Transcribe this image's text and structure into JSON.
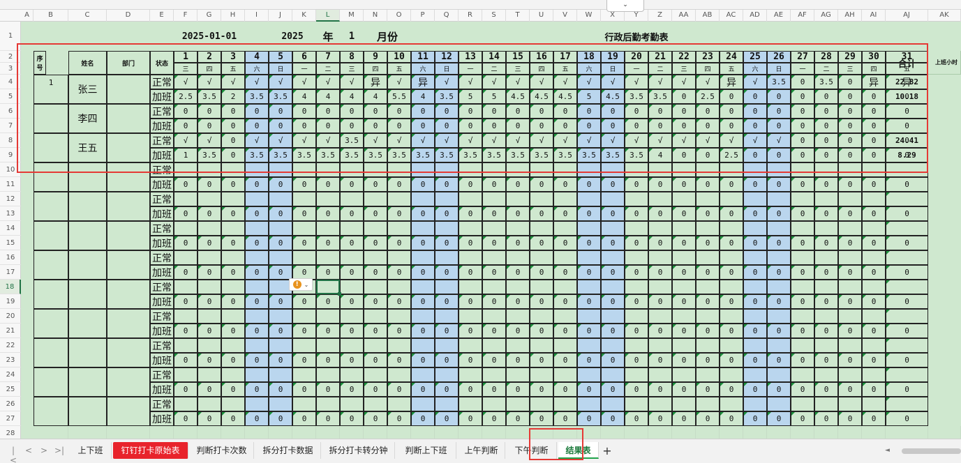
{
  "spreadsheet": {
    "columns": [
      "A",
      "B",
      "C",
      "D",
      "E",
      "F",
      "G",
      "H",
      "I",
      "J",
      "K",
      "L",
      "M",
      "N",
      "O",
      "P",
      "Q",
      "R",
      "S",
      "T",
      "U",
      "V",
      "W",
      "X",
      "Y",
      "Z",
      "AA",
      "AB",
      "AC",
      "AD",
      "AE",
      "AF",
      "AG",
      "AH",
      "AI",
      "AJ",
      "AK"
    ],
    "active_column": "L",
    "row_numbers": [
      "1",
      "2",
      "3",
      "4",
      "5",
      "6",
      "7",
      "8",
      "9",
      "10",
      "11",
      "12",
      "13",
      "14",
      "15",
      "16",
      "17",
      "18",
      "19",
      "20",
      "21",
      "22",
      "23",
      "24",
      "25",
      "26",
      "27",
      "28"
    ],
    "active_row": "18",
    "title_row": {
      "date": "2025-01-01",
      "year": "2025",
      "year_label": "年",
      "month": "1",
      "month_label": "月份",
      "title": "行政后勤考勤表"
    },
    "headers": {
      "seq": "序号",
      "name": "姓名",
      "dept": "部门",
      "status": "状态",
      "total": "合计",
      "overflow": "上班小时"
    },
    "days": [
      "1",
      "2",
      "3",
      "4",
      "5",
      "6",
      "7",
      "8",
      "9",
      "10",
      "11",
      "12",
      "13",
      "14",
      "15",
      "16",
      "17",
      "18",
      "19",
      "20",
      "21",
      "22",
      "23",
      "24",
      "25",
      "26",
      "27",
      "28",
      "29",
      "30",
      "31"
    ],
    "weekdays": [
      "三",
      "四",
      "五",
      "六",
      "日",
      "一",
      "二",
      "三",
      "四",
      "五",
      "六",
      "日",
      "一",
      "二",
      "三",
      "四",
      "五",
      "六",
      "日",
      "一",
      "二",
      "三",
      "四",
      "五",
      "六",
      "日",
      "一",
      "二",
      "三",
      "四",
      "五"
    ],
    "blue_day_indices": [
      3,
      4,
      10,
      11,
      17,
      18,
      24,
      25
    ],
    "status_labels": {
      "normal": "正常",
      "overtime": "加班"
    },
    "employees": [
      {
        "seq": "1",
        "name": "张三",
        "normal": [
          "√",
          "√",
          "√",
          "√",
          "√",
          "√",
          "√",
          "√",
          "异",
          "√",
          "异",
          "√",
          "√",
          "√",
          "√",
          "√",
          "√",
          "√",
          "√",
          "√",
          "√",
          "√",
          "√",
          "异",
          "√",
          "3.5",
          "0",
          "3.5",
          "0",
          "异",
          "异"
        ],
        "normal_total": "22.82",
        "overtime": [
          "2.5",
          "3.5",
          "2",
          "3.5",
          "3.5",
          "4",
          "4",
          "4",
          "4",
          "5.5",
          "4",
          "3.5",
          "5",
          "5",
          "4.5",
          "4.5",
          "4.5",
          "5",
          "4.5",
          "3.5",
          "3.5",
          "0",
          "2.5",
          "0",
          "0",
          "0",
          "0",
          "0",
          "0",
          "0",
          "0"
        ],
        "overtime_total": "10.18"
      },
      {
        "seq": "",
        "name": "李四",
        "normal": [
          "0",
          "0",
          "0",
          "0",
          "0",
          "0",
          "0",
          "0",
          "0",
          "0",
          "0",
          "0",
          "0",
          "0",
          "0",
          "0",
          "0",
          "0",
          "0",
          "0",
          "0",
          "0",
          "0",
          "0",
          "0",
          "0",
          "0",
          "0",
          "0",
          "0",
          "0"
        ],
        "normal_total": "",
        "overtime": [
          "0",
          "0",
          "0",
          "0",
          "0",
          "0",
          "0",
          "0",
          "0",
          "0",
          "0",
          "0",
          "0",
          "0",
          "0",
          "0",
          "0",
          "0",
          "0",
          "0",
          "0",
          "0",
          "0",
          "0",
          "0",
          "0",
          "0",
          "0",
          "0",
          "0",
          "0"
        ],
        "overtime_total": ""
      },
      {
        "seq": "",
        "name": "王五",
        "normal": [
          "√",
          "√",
          "0",
          "√",
          "√",
          "√",
          "√",
          "3.5",
          "√",
          "√",
          "√",
          "√",
          "√",
          "√",
          "√",
          "√",
          "√",
          "√",
          "√",
          "√",
          "√",
          "√",
          "√",
          "√",
          "√",
          "√",
          "0",
          "0",
          "0",
          "0",
          "0"
        ],
        "normal_total": "24.41",
        "overtime": [
          "1",
          "3.5",
          "0",
          "3.5",
          "3.5",
          "3.5",
          "3.5",
          "3.5",
          "3.5",
          "3.5",
          "3.5",
          "3.5",
          "3.5",
          "3.5",
          "3.5",
          "3.5",
          "3.5",
          "3.5",
          "3.5",
          "3.5",
          "4",
          "0",
          "0",
          "2.5",
          "0",
          "0",
          "0",
          "0",
          "0",
          "0",
          "0"
        ],
        "overtime_total": "8.29"
      }
    ],
    "zero_value": "0"
  },
  "sheet_tabs": {
    "nav": [
      "|<",
      "<",
      ">",
      ">|"
    ],
    "tabs": [
      "上下班",
      "钉钉打卡原始表",
      "判断打卡次数",
      "拆分打卡数据",
      "拆分打卡转分钟",
      "判断上下班",
      "上午判断",
      "下午判断",
      "结果表"
    ],
    "active": "结果表",
    "add_label": "+"
  },
  "colors": {
    "grid_green": "#cfe8cf",
    "weekend_blue": "#bad6ee",
    "highlight_red": "#e53935",
    "active_green": "#217346"
  }
}
